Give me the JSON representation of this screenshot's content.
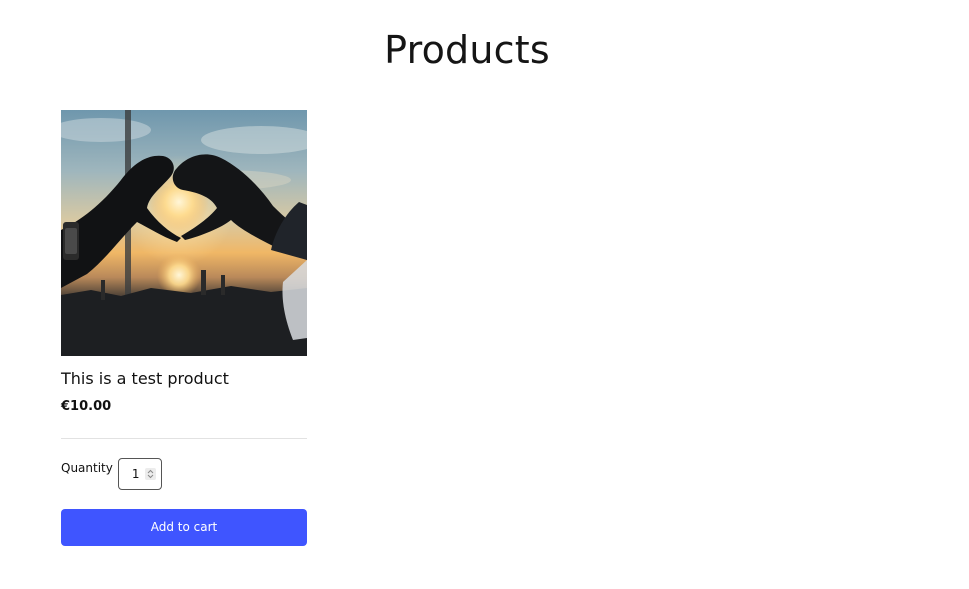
{
  "page": {
    "title": "Products"
  },
  "product": {
    "name": "This is a test product",
    "price": "€10.00",
    "image_subject": "hands-heart-sunset"
  },
  "quantity": {
    "label": "Quantity",
    "value": "1"
  },
  "actions": {
    "add_to_cart_label": "Add to cart"
  },
  "colors": {
    "accent": "#3f55ff",
    "text": "#111111",
    "divider": "#e2e2e2"
  }
}
